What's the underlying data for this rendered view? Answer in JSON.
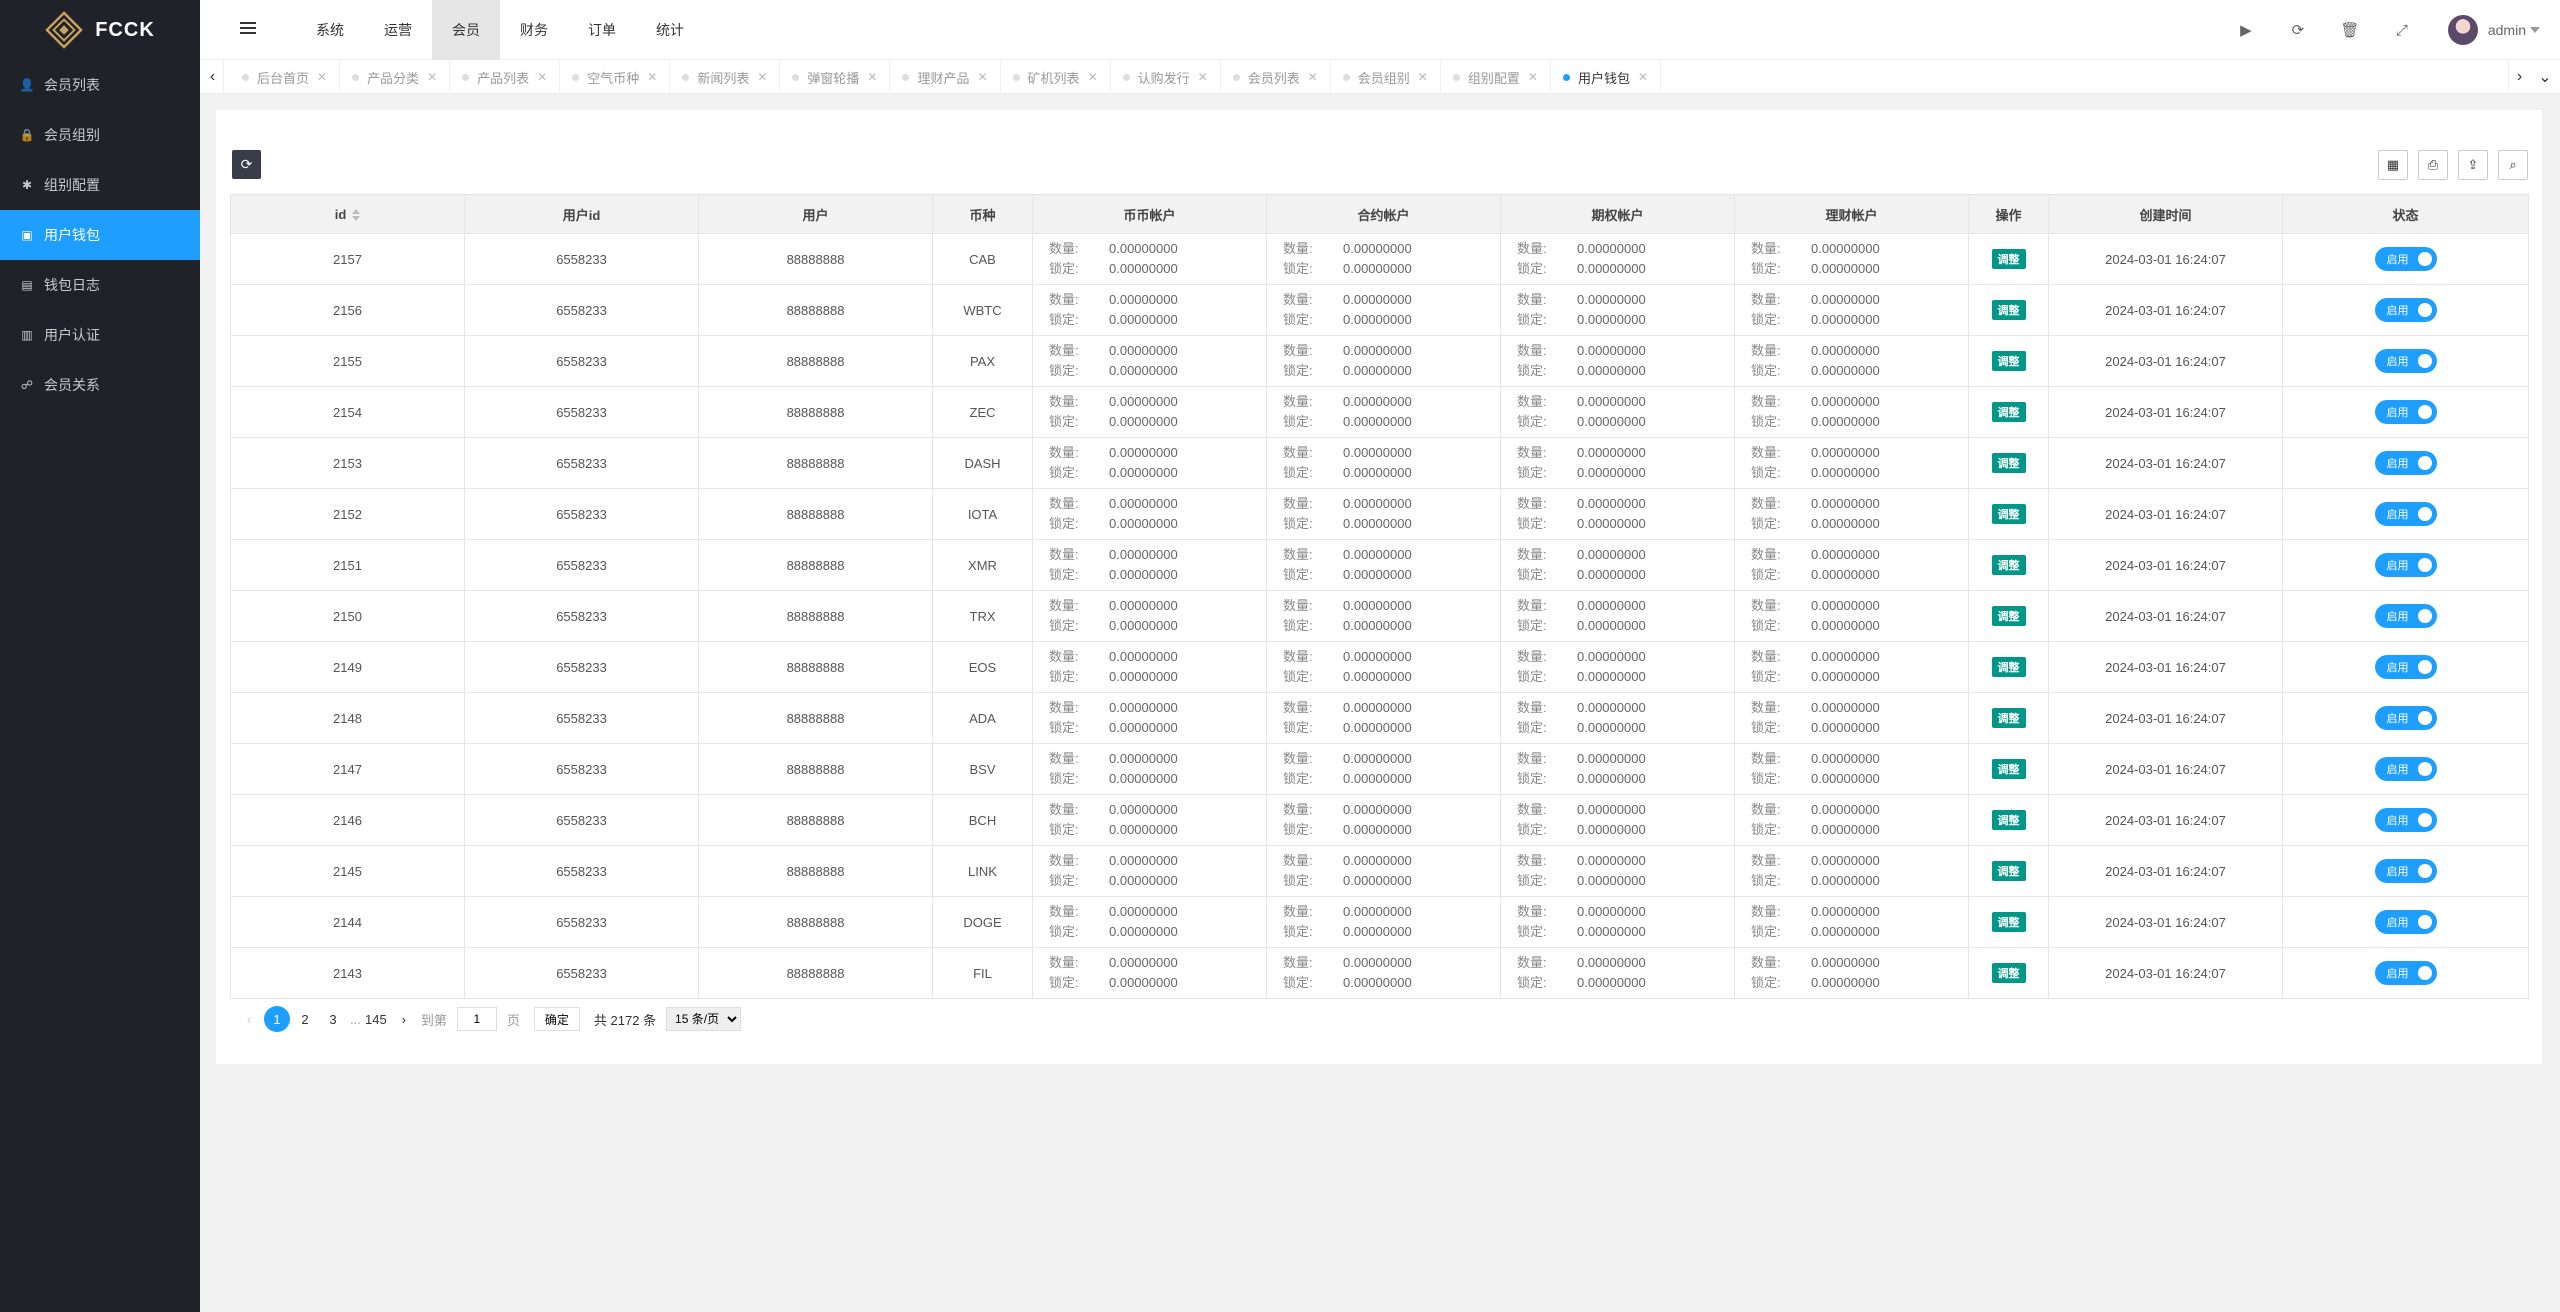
{
  "brand": {
    "name": "FCCK"
  },
  "sidebar": {
    "items": [
      {
        "label": "会员列表",
        "icon": "user-icon"
      },
      {
        "label": "会员组别",
        "icon": "lock-icon"
      },
      {
        "label": "组别配置",
        "icon": "gear-icon"
      },
      {
        "label": "用户钱包",
        "icon": "wallet-icon",
        "active": true
      },
      {
        "label": "钱包日志",
        "icon": "log-icon"
      },
      {
        "label": "用户认证",
        "icon": "id-card-icon"
      },
      {
        "label": "会员关系",
        "icon": "network-icon"
      }
    ]
  },
  "header": {
    "nav": [
      "系统",
      "运营",
      "会员",
      "财务",
      "订单",
      "统计"
    ],
    "active_nav": "会员",
    "user": "admin"
  },
  "tabs": [
    {
      "label": "后台首页"
    },
    {
      "label": "产品分类"
    },
    {
      "label": "产品列表"
    },
    {
      "label": "空气币种"
    },
    {
      "label": "新闻列表"
    },
    {
      "label": "弹窗轮播"
    },
    {
      "label": "理财产品"
    },
    {
      "label": "矿机列表"
    },
    {
      "label": "认购发行"
    },
    {
      "label": "会员列表"
    },
    {
      "label": "会员组别"
    },
    {
      "label": "组别配置"
    },
    {
      "label": "用户钱包",
      "active": true
    }
  ],
  "table": {
    "columns": [
      "id",
      "用户id",
      "用户",
      "币种",
      "币币帐户",
      "合约帐户",
      "期权帐户",
      "理财帐户",
      "操作",
      "创建时间",
      "状态"
    ],
    "acct_labels": {
      "qty": "数量:",
      "locked": "锁定:"
    },
    "btn_adjust": "调整",
    "switch_label": "启用",
    "rows": [
      {
        "id": "2157",
        "uid": "6558233",
        "user": "88888888",
        "coin": "CAB",
        "qty": "0.00000000",
        "locked": "0.00000000",
        "created": "2024-03-01 16:24:07"
      },
      {
        "id": "2156",
        "uid": "6558233",
        "user": "88888888",
        "coin": "WBTC",
        "qty": "0.00000000",
        "locked": "0.00000000",
        "created": "2024-03-01 16:24:07"
      },
      {
        "id": "2155",
        "uid": "6558233",
        "user": "88888888",
        "coin": "PAX",
        "qty": "0.00000000",
        "locked": "0.00000000",
        "created": "2024-03-01 16:24:07"
      },
      {
        "id": "2154",
        "uid": "6558233",
        "user": "88888888",
        "coin": "ZEC",
        "qty": "0.00000000",
        "locked": "0.00000000",
        "created": "2024-03-01 16:24:07"
      },
      {
        "id": "2153",
        "uid": "6558233",
        "user": "88888888",
        "coin": "DASH",
        "qty": "0.00000000",
        "locked": "0.00000000",
        "created": "2024-03-01 16:24:07"
      },
      {
        "id": "2152",
        "uid": "6558233",
        "user": "88888888",
        "coin": "IOTA",
        "qty": "0.00000000",
        "locked": "0.00000000",
        "created": "2024-03-01 16:24:07"
      },
      {
        "id": "2151",
        "uid": "6558233",
        "user": "88888888",
        "coin": "XMR",
        "qty": "0.00000000",
        "locked": "0.00000000",
        "created": "2024-03-01 16:24:07"
      },
      {
        "id": "2150",
        "uid": "6558233",
        "user": "88888888",
        "coin": "TRX",
        "qty": "0.00000000",
        "locked": "0.00000000",
        "created": "2024-03-01 16:24:07"
      },
      {
        "id": "2149",
        "uid": "6558233",
        "user": "88888888",
        "coin": "EOS",
        "qty": "0.00000000",
        "locked": "0.00000000",
        "created": "2024-03-01 16:24:07"
      },
      {
        "id": "2148",
        "uid": "6558233",
        "user": "88888888",
        "coin": "ADA",
        "qty": "0.00000000",
        "locked": "0.00000000",
        "created": "2024-03-01 16:24:07"
      },
      {
        "id": "2147",
        "uid": "6558233",
        "user": "88888888",
        "coin": "BSV",
        "qty": "0.00000000",
        "locked": "0.00000000",
        "created": "2024-03-01 16:24:07"
      },
      {
        "id": "2146",
        "uid": "6558233",
        "user": "88888888",
        "coin": "BCH",
        "qty": "0.00000000",
        "locked": "0.00000000",
        "created": "2024-03-01 16:24:07"
      },
      {
        "id": "2145",
        "uid": "6558233",
        "user": "88888888",
        "coin": "LINK",
        "qty": "0.00000000",
        "locked": "0.00000000",
        "created": "2024-03-01 16:24:07"
      },
      {
        "id": "2144",
        "uid": "6558233",
        "user": "88888888",
        "coin": "DOGE",
        "qty": "0.00000000",
        "locked": "0.00000000",
        "created": "2024-03-01 16:24:07"
      },
      {
        "id": "2143",
        "uid": "6558233",
        "user": "88888888",
        "coin": "FIL",
        "qty": "0.00000000",
        "locked": "0.00000000",
        "created": "2024-03-01 16:24:07"
      }
    ]
  },
  "pager": {
    "pages": [
      "1",
      "2",
      "3"
    ],
    "ellipsis": "...",
    "last": "145",
    "goto_label": "到第",
    "goto_value": "1",
    "page_unit": "页",
    "ok": "确定",
    "total": "共 2172 条",
    "per_page": "15 条/页"
  },
  "colors": {
    "accent": "#1e9fff",
    "sidebar": "#20222a",
    "adjust": "#009688"
  }
}
